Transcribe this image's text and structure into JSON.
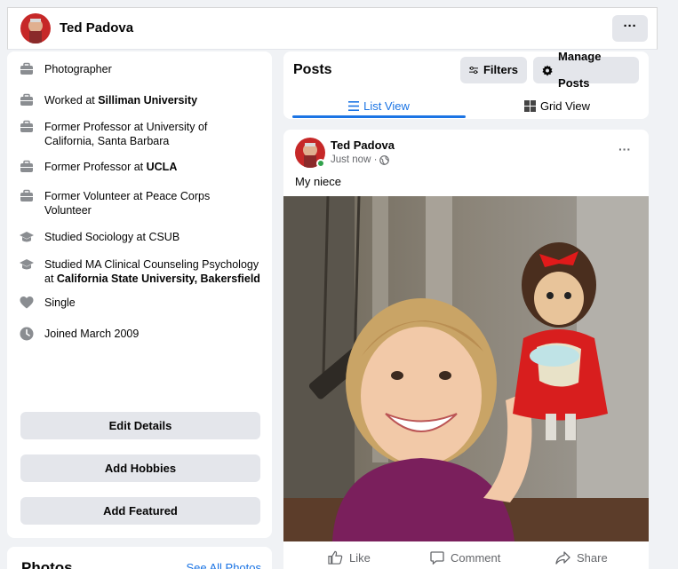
{
  "profile": {
    "name": "Ted Padova",
    "more_label": "···"
  },
  "intro": {
    "items": [
      {
        "icon": "briefcase-icon",
        "text": "Photographer"
      },
      {
        "icon": "briefcase-icon",
        "pre": "Worked at ",
        "bold": "Silliman University"
      },
      {
        "icon": "briefcase-icon",
        "text": "Former Professor at University of California, Santa Barbara"
      },
      {
        "icon": "briefcase-icon",
        "pre": "Former Professor at ",
        "bold": "UCLA"
      },
      {
        "icon": "briefcase-icon",
        "text": "Former Volunteer at Peace Corps Volunteer"
      },
      {
        "icon": "graduation-cap-icon",
        "text": "Studied Sociology at CSUB"
      },
      {
        "icon": "graduation-cap-icon",
        "pre": "Studied MA Clinical Counseling Psychology at ",
        "bold": "California State University, Bakersfield"
      },
      {
        "icon": "heart-icon",
        "text": "Single"
      },
      {
        "icon": "clock-icon",
        "text": "Joined March 2009"
      }
    ],
    "buttons": {
      "edit_details": "Edit Details",
      "add_hobbies": "Add Hobbies",
      "add_featured": "Add Featured"
    }
  },
  "photos": {
    "title": "Photos",
    "see_all": "See All Photos"
  },
  "posts": {
    "title": "Posts",
    "filters_label": "Filters",
    "manage_label": "Manage Posts",
    "tabs": {
      "list_view": "List View",
      "grid_view": "Grid View"
    }
  },
  "post": {
    "author": "Ted Padova",
    "time": "Just now ·",
    "more": "···",
    "caption": "My niece",
    "actions": {
      "like": "Like",
      "comment": "Comment",
      "share": "Share"
    }
  },
  "colors": {
    "accent": "#1b74e4",
    "button_bg": "#e4e6eb",
    "online": "#31a24c"
  }
}
